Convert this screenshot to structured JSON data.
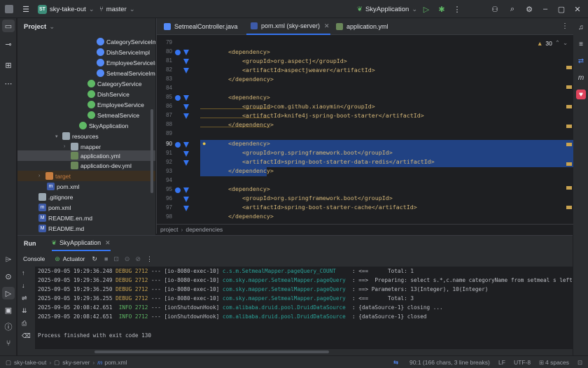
{
  "titlebar": {
    "project_badge": "ST",
    "project_name": "sky-take-out",
    "branch": "master",
    "run_config": "SkyApplication"
  },
  "project_panel": {
    "title": "Project",
    "items": [
      {
        "label": "CategoryServiceIm",
        "icon": "class-icon"
      },
      {
        "label": "DishServiceImpl",
        "icon": "class-icon"
      },
      {
        "label": "EmployeeServiceIn",
        "icon": "class-icon"
      },
      {
        "label": "SetmealServiceImp",
        "icon": "class-icon"
      },
      {
        "label": "CategoryService",
        "icon": "interface-icon"
      },
      {
        "label": "DishService",
        "icon": "interface-icon"
      },
      {
        "label": "EmployeeService",
        "icon": "interface-icon"
      },
      {
        "label": "SetmealService",
        "icon": "interface-icon"
      },
      {
        "label": "SkyApplication",
        "icon": "spring-class-icon"
      },
      {
        "label": "resources",
        "icon": "folder-icon"
      },
      {
        "label": "mapper",
        "icon": "folder-icon"
      },
      {
        "label": "application.yml",
        "icon": "yaml-icon"
      },
      {
        "label": "application-dev.yml",
        "icon": "yaml-icon"
      },
      {
        "label": "target",
        "icon": "folder-icon"
      },
      {
        "label": "pom.xml",
        "icon": "maven-icon"
      },
      {
        "label": ".gitignore",
        "icon": "gitignore-icon"
      },
      {
        "label": "pom.xml",
        "icon": "maven-icon"
      },
      {
        "label": "README.en.md",
        "icon": "markdown-icon"
      },
      {
        "label": "README.md",
        "icon": "markdown-icon"
      }
    ]
  },
  "editor": {
    "tabs": [
      {
        "label": "SetmealController.java"
      },
      {
        "label": "pom.xml (sky-server)"
      },
      {
        "label": "application.yml"
      }
    ],
    "warnings_count": "30",
    "lines": [
      {
        "n": "79",
        "text": ""
      },
      {
        "n": "80",
        "text": "        <dependency>"
      },
      {
        "n": "81",
        "text": "            <groupId>org.aspectj</groupId>"
      },
      {
        "n": "82",
        "text": "            <artifactId>aspectjweaver</artifactId>"
      },
      {
        "n": "83",
        "text": "        </dependency>"
      },
      {
        "n": "84",
        "text": ""
      },
      {
        "n": "85",
        "text": "        <dependency>"
      },
      {
        "n": "86",
        "text": "            <groupId>com.github.xiaoymin</groupId>"
      },
      {
        "n": "87",
        "text": "            <artifactId>knife4j-spring-boot-starter</artifactId>"
      },
      {
        "n": "88",
        "text": "        </dependency>"
      },
      {
        "n": "89",
        "text": ""
      },
      {
        "n": "90",
        "text": "        <dependency>"
      },
      {
        "n": "91",
        "text": "            <groupId>org.springframework.boot</groupId>"
      },
      {
        "n": "92",
        "text": "            <artifactId>spring-boot-starter-data-redis</artifactId>"
      },
      {
        "n": "93",
        "text": "        </dependency>"
      },
      {
        "n": "94",
        "text": ""
      },
      {
        "n": "95",
        "text": "        <dependency>"
      },
      {
        "n": "96",
        "text": "            <groupId>org.springframework.boot</groupId>"
      },
      {
        "n": "97",
        "text": "            <artifactId>spring-boot-starter-cache</artifactId>"
      },
      {
        "n": "98",
        "text": "        </dependency>"
      }
    ],
    "breadcrumb": [
      "project",
      "dependencies"
    ]
  },
  "run_panel": {
    "tabs": [
      "Run",
      "SkyApplication"
    ],
    "subtabs": [
      "Console",
      "Actuator"
    ],
    "logs": [
      {
        "ts": "2025-09-05 19:29:36.248",
        "level": "DEBUG",
        "pid": "2712",
        "thread": "--- [io-8080-exec-10]",
        "logger": "c.s.m.SetmealMapper.pageQuery_COUNT",
        "msg": ": <==      Total: 1"
      },
      {
        "ts": "2025-09-05 19:29:36.249",
        "level": "DEBUG",
        "pid": "2712",
        "thread": "--- [io-8080-exec-10]",
        "logger": "com.sky.mapper.SetmealMapper.pageQuery",
        "msg": ": ==>  Preparing: select s.*,c.name categoryName from setmeal s left"
      },
      {
        "ts": "2025-09-05 19:29:36.250",
        "level": "DEBUG",
        "pid": "2712",
        "thread": "--- [io-8080-exec-10]",
        "logger": "com.sky.mapper.SetmealMapper.pageQuery",
        "msg": ": ==> Parameters: 13(Integer), 10(Integer)"
      },
      {
        "ts": "2025-09-05 19:29:36.255",
        "level": "DEBUG",
        "pid": "2712",
        "thread": "--- [io-8080-exec-10]",
        "logger": "com.sky.mapper.SetmealMapper.pageQuery",
        "msg": ": <==      Total: 3"
      },
      {
        "ts": "2025-09-05 20:08:42.651",
        "level": " INFO",
        "pid": "2712",
        "thread": "--- [ionShutdownHook]",
        "logger": "com.alibaba.druid.pool.DruidDataSource",
        "msg": ": {dataSource-1} closing ..."
      },
      {
        "ts": "2025-09-05 20:08:42.651",
        "level": " INFO",
        "pid": "2712",
        "thread": "--- [ionShutdownHook]",
        "logger": "com.alibaba.druid.pool.DruidDataSource",
        "msg": ": {dataSource-1} closed"
      }
    ],
    "exit_message": "Process finished with exit code 130"
  },
  "statusbar": {
    "path": [
      "sky-take-out",
      "sky-server",
      "pom.xml"
    ],
    "position": "90:1 (166 chars, 3 line breaks)",
    "line_sep": "LF",
    "encoding": "UTF-8",
    "indent": "4 spaces"
  },
  "colors": {
    "accent": "#3574f0",
    "selection": "#214283",
    "xml_tag": "#d5b778",
    "debug": "#c8a250",
    "info": "#5fb865",
    "logger": "#2aa198"
  }
}
